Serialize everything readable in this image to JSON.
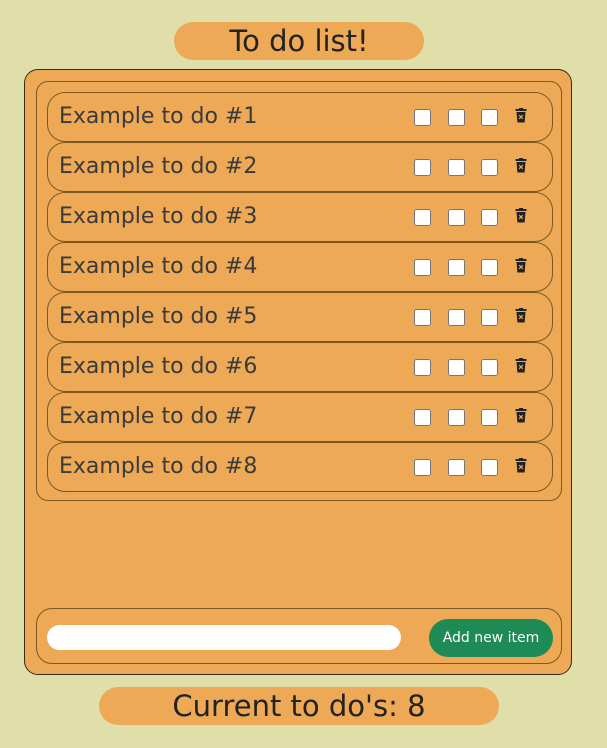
{
  "header": {
    "title": "To do list!"
  },
  "todos": [
    {
      "text": "Example to do #1",
      "checks": [
        false,
        false,
        false
      ]
    },
    {
      "text": "Example to do #2",
      "checks": [
        false,
        false,
        false
      ]
    },
    {
      "text": "Example to do #3",
      "checks": [
        false,
        false,
        false
      ]
    },
    {
      "text": "Example to do #4",
      "checks": [
        false,
        false,
        false
      ]
    },
    {
      "text": "Example to do #5",
      "checks": [
        false,
        false,
        false
      ]
    },
    {
      "text": "Example to do #6",
      "checks": [
        false,
        false,
        false
      ]
    },
    {
      "text": "Example to do #7",
      "checks": [
        false,
        false,
        false
      ]
    },
    {
      "text": "Example to do #8",
      "checks": [
        false,
        false,
        false
      ]
    }
  ],
  "icons": {
    "delete": "trash-icon"
  },
  "new_item": {
    "value": "",
    "placeholder": "",
    "button_label": "Add new item"
  },
  "footer": {
    "count_label": "Current to do's: 8"
  },
  "colors": {
    "background": "#e1dfa9",
    "panel": "#eda956",
    "button": "#1e8a55"
  }
}
